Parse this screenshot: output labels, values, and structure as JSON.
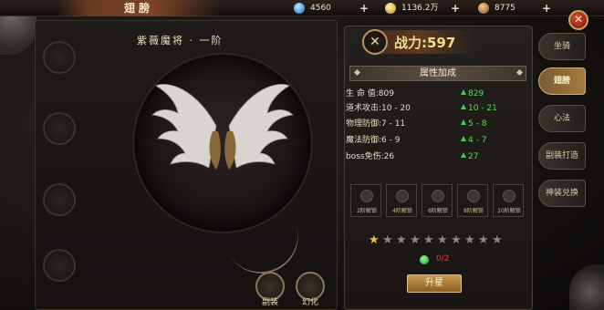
{
  "window": {
    "title": "翅膀"
  },
  "resources": [
    {
      "icon": "diamond-icon",
      "value": "4560",
      "color": "#3a8ee8"
    },
    {
      "icon": "gold-ingot-icon",
      "value": "1136.2万",
      "color": "#e0b040"
    },
    {
      "icon": "coin-icon",
      "value": "8775",
      "color": "#c98a3a"
    }
  ],
  "wing": {
    "name": "紫薇魔将 · 一阶",
    "current_stars": 1,
    "max_stars": 10
  },
  "actions": [
    {
      "label": "副装"
    },
    {
      "label": "幻化"
    }
  ],
  "power": {
    "label": "战力:597"
  },
  "attributes": {
    "header": "属性加成",
    "rows": [
      {
        "label": "生 命 值:809",
        "gain": "829"
      },
      {
        "label": "道术攻击:10 - 20",
        "gain": "10 - 21"
      },
      {
        "label": "物理防御:7 - 11",
        "gain": "5 - 8"
      },
      {
        "label": "魔法防御:6 - 9",
        "gain": "4 - 7"
      },
      {
        "label": "boss免伤:26",
        "gain": "27"
      }
    ]
  },
  "unlock_slots": [
    {
      "label": "2阶解锁"
    },
    {
      "label": "4阶解锁"
    },
    {
      "label": "6阶解锁"
    },
    {
      "label": "8阶解锁"
    },
    {
      "label": "10阶解锁"
    }
  ],
  "material": {
    "count": "0/2"
  },
  "upgrade_button": "升星",
  "tabs": [
    {
      "label": "坐骑",
      "active": false
    },
    {
      "label": "翅膀",
      "active": true
    },
    {
      "label": "心法",
      "active": false
    },
    {
      "label": "副装打造",
      "active": false
    },
    {
      "label": "神装兑换",
      "active": false
    }
  ],
  "colors": {
    "accent_gold": "#c99a4f",
    "gain_green": "#52e052",
    "power_text": "#f6d98a",
    "warning_red": "#e03a2a"
  }
}
